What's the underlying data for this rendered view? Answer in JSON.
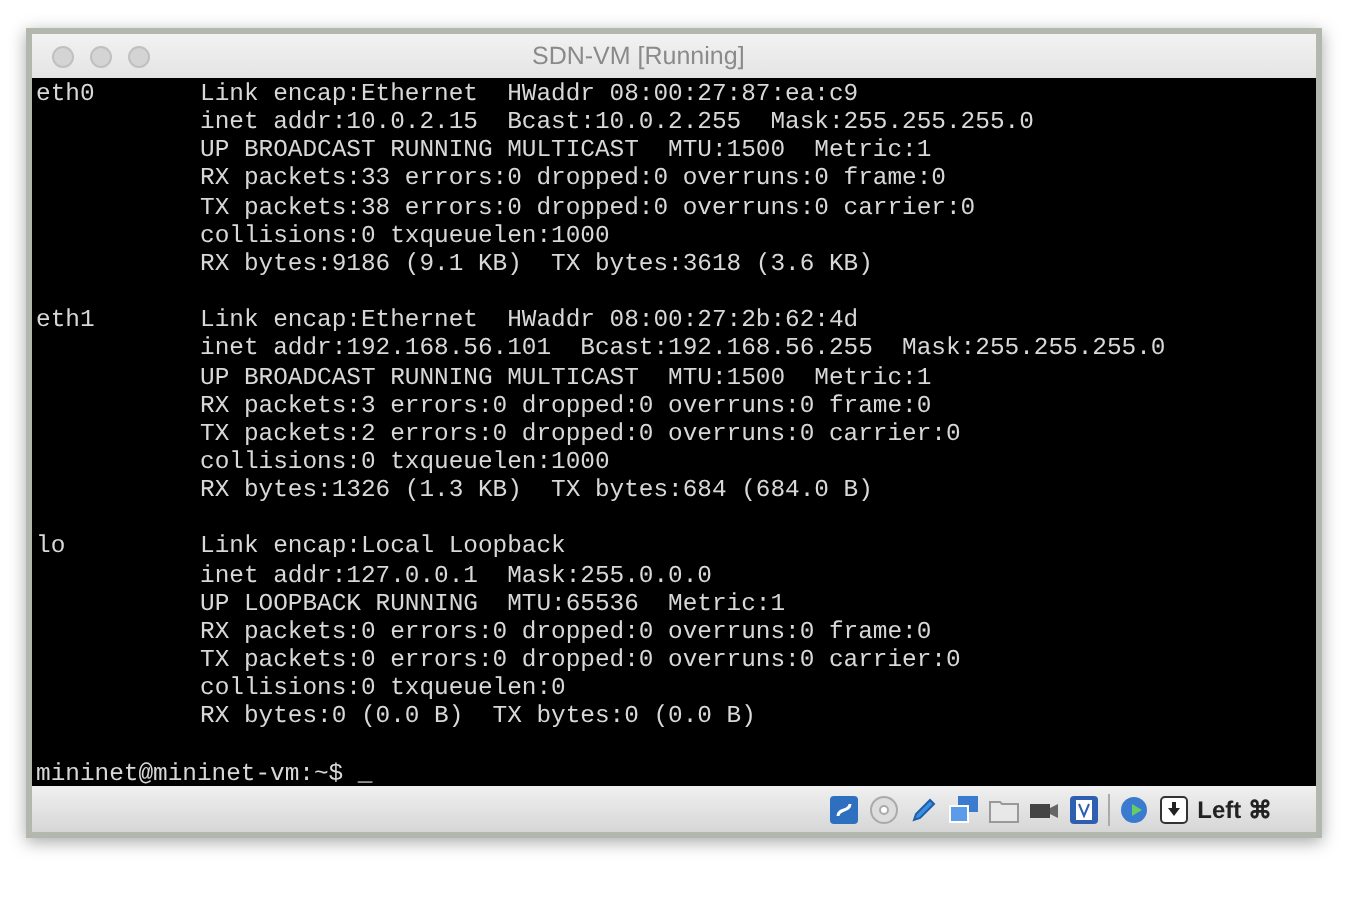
{
  "window": {
    "title": "SDN-VM [Running]"
  },
  "terminal": {
    "interfaces": [
      {
        "name": "eth0",
        "lines": [
          "Link encap:Ethernet  HWaddr 08:00:27:87:ea:c9",
          "inet addr:10.0.2.15  Bcast:10.0.2.255  Mask:255.255.255.0",
          "UP BROADCAST RUNNING MULTICAST  MTU:1500  Metric:1",
          "RX packets:33 errors:0 dropped:0 overruns:0 frame:0",
          "TX packets:38 errors:0 dropped:0 overruns:0 carrier:0",
          "collisions:0 txqueuelen:1000",
          "RX bytes:9186 (9.1 KB)  TX bytes:3618 (3.6 KB)"
        ]
      },
      {
        "name": "eth1",
        "lines": [
          "Link encap:Ethernet  HWaddr 08:00:27:2b:62:4d",
          "inet addr:192.168.56.101  Bcast:192.168.56.255  Mask:255.255.255.0",
          "UP BROADCAST RUNNING MULTICAST  MTU:1500  Metric:1",
          "RX packets:3 errors:0 dropped:0 overruns:0 frame:0",
          "TX packets:2 errors:0 dropped:0 overruns:0 carrier:0",
          "collisions:0 txqueuelen:1000",
          "RX bytes:1326 (1.3 KB)  TX bytes:684 (684.0 B)"
        ]
      },
      {
        "name": "lo",
        "lines": [
          "Link encap:Local Loopback",
          "inet addr:127.0.0.1  Mask:255.0.0.0",
          "UP LOOPBACK RUNNING  MTU:65536  Metric:1",
          "RX packets:0 errors:0 dropped:0 overruns:0 frame:0",
          "TX packets:0 errors:0 dropped:0 overruns:0 carrier:0",
          "collisions:0 txqueuelen:0",
          "RX bytes:0 (0.0 B)  TX bytes:0 (0.0 B)"
        ]
      }
    ],
    "prompt": "mininet@mininet-vm:~$",
    "cursor": "_"
  },
  "status_bar": {
    "host_key": "Left ⌘"
  }
}
